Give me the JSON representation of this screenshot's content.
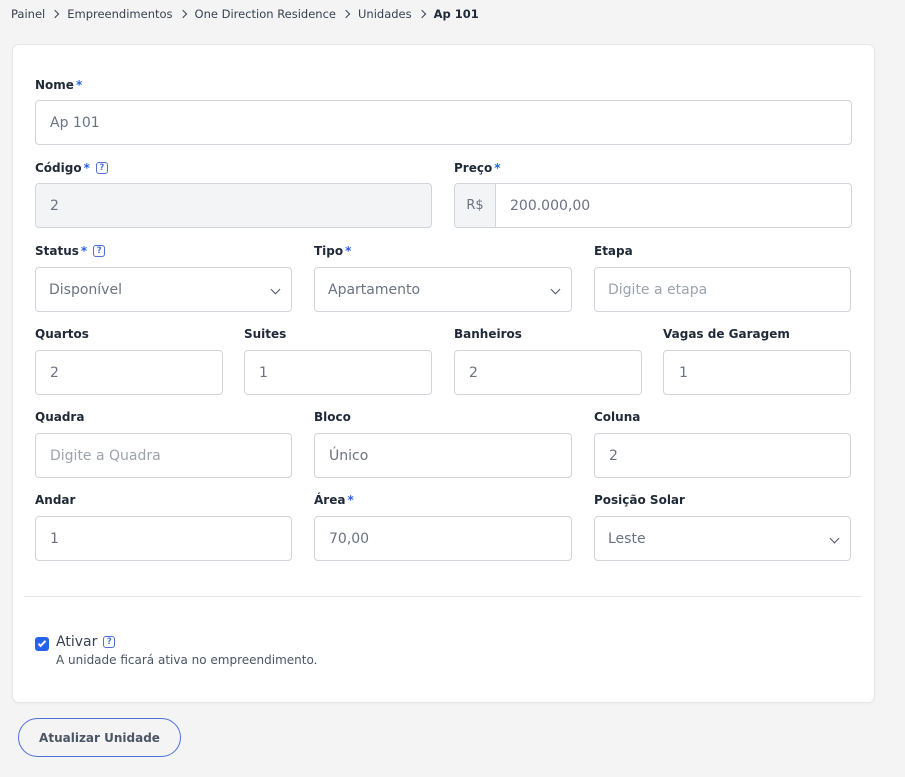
{
  "breadcrumb": {
    "items": [
      "Painel",
      "Empreendimentos",
      "One Direction Residence",
      "Unidades"
    ],
    "current": "Ap 101"
  },
  "form": {
    "nome": {
      "label": "Nome",
      "required_mark": "*",
      "value": "Ap 101"
    },
    "codigo": {
      "label": "Código",
      "required_mark": "*",
      "value": "2"
    },
    "preco": {
      "label": "Preço",
      "required_mark": "*",
      "prefix": "R$",
      "value": "200.000,00"
    },
    "status": {
      "label": "Status",
      "required_mark": "*",
      "value": "Disponível"
    },
    "tipo": {
      "label": "Tipo",
      "required_mark": "*",
      "value": "Apartamento"
    },
    "etapa": {
      "label": "Etapa",
      "placeholder": "Digite a etapa"
    },
    "quartos": {
      "label": "Quartos",
      "value": "2"
    },
    "suites": {
      "label": "Suites",
      "value": "1"
    },
    "banheiros": {
      "label": "Banheiros",
      "value": "2"
    },
    "vagas": {
      "label": "Vagas de Garagem",
      "value": "1"
    },
    "quadra": {
      "label": "Quadra",
      "placeholder": "Digite a Quadra"
    },
    "bloco": {
      "label": "Bloco",
      "value": "Único"
    },
    "coluna": {
      "label": "Coluna",
      "value": "2"
    },
    "andar": {
      "label": "Andar",
      "value": "1"
    },
    "area": {
      "label": "Área",
      "required_mark": "*",
      "value": "70,00"
    },
    "posicao_solar": {
      "label": "Posição Solar",
      "value": "Leste"
    },
    "ativar": {
      "label": "Ativar",
      "checked": true,
      "description": "A unidade ficará ativa no empreendimento."
    }
  },
  "help_icon": "?",
  "submit_label": "Atualizar Unidade",
  "colors": {
    "accent": "#2563eb",
    "border": "#d1d5db",
    "background": "#f4f4f5"
  },
  "icons": [
    "chevron-right-icon",
    "help-icon",
    "chevron-down-icon",
    "check-icon"
  ]
}
